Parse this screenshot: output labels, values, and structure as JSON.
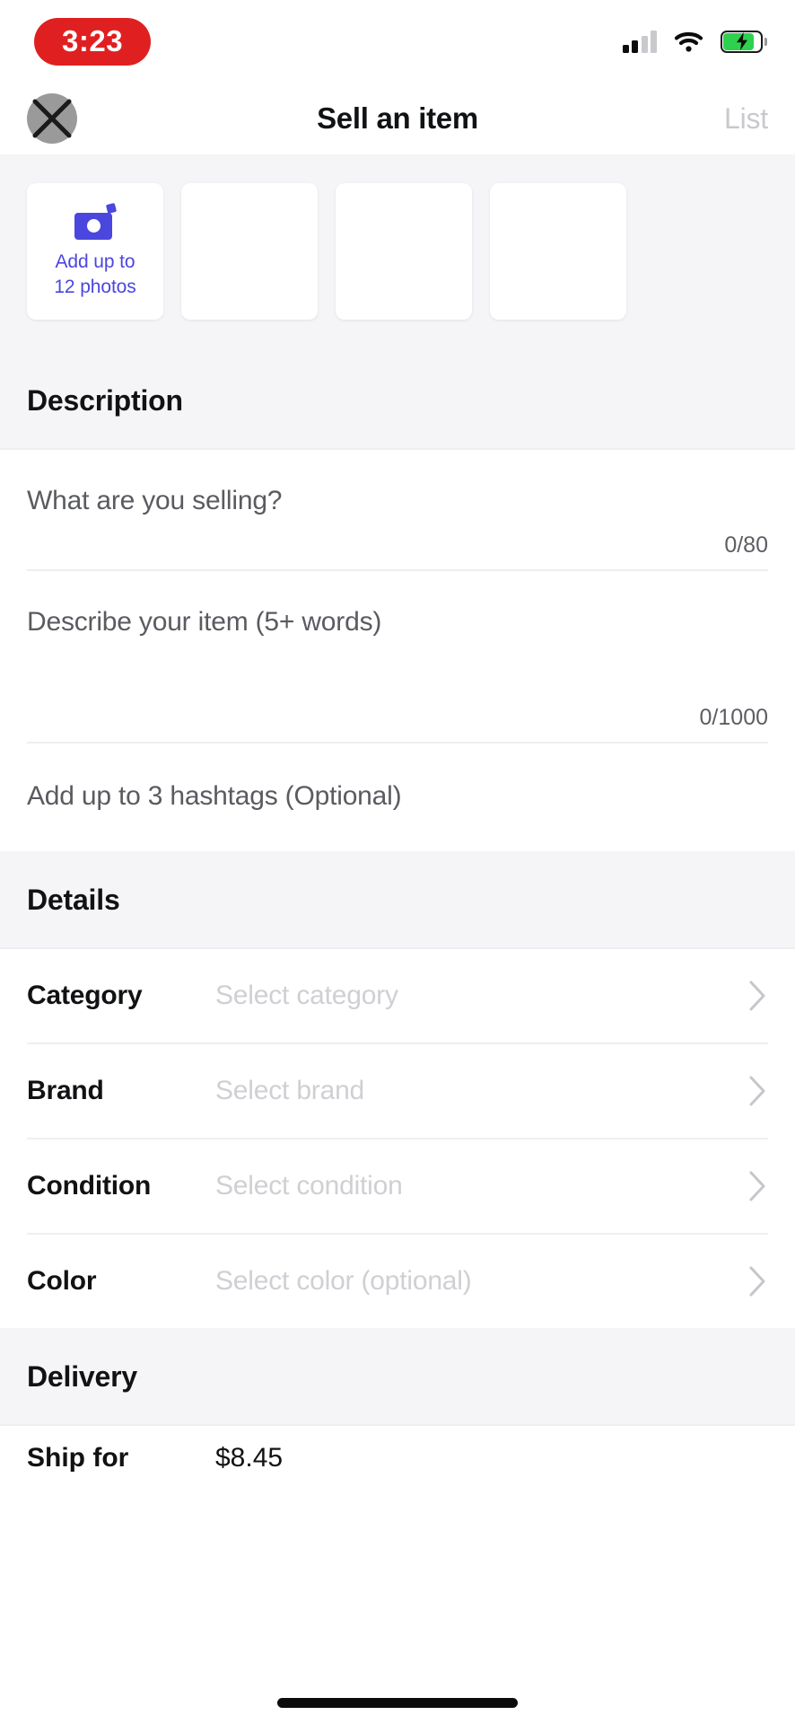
{
  "status_bar": {
    "time": "3:23",
    "time_pill_color": "#E02020",
    "signal_icon": "cellular-signal-icon",
    "wifi_icon": "wifi-icon",
    "battery_icon": "battery-charging-icon",
    "battery_fill_color": "#2ED14E"
  },
  "nav": {
    "close_icon": "close-icon",
    "title": "Sell an item",
    "action_label": "List"
  },
  "photos": {
    "add_label_line1": "Add up to",
    "add_label_line2": "12 photos",
    "camera_icon": "camera-icon",
    "accent_color": "#4B46DE",
    "empty_tiles": 3
  },
  "description_section": {
    "heading": "Description",
    "title_field": {
      "placeholder": "What are you selling?",
      "value": "",
      "counter": "0/80"
    },
    "desc_field": {
      "placeholder": "Describe your item (5+ words)",
      "value": "",
      "counter": "0/1000"
    },
    "hashtags_field": {
      "placeholder": "Add up to 3 hashtags (Optional)",
      "value": ""
    }
  },
  "details_section": {
    "heading": "Details",
    "rows": [
      {
        "label": "Category",
        "value": "Select category",
        "chevron": "chevron-right-icon"
      },
      {
        "label": "Brand",
        "value": "Select brand",
        "chevron": "chevron-right-icon"
      },
      {
        "label": "Condition",
        "value": "Select condition",
        "chevron": "chevron-right-icon"
      },
      {
        "label": "Color",
        "value": "Select color (optional)",
        "chevron": "chevron-right-icon"
      }
    ]
  },
  "delivery_section": {
    "heading": "Delivery",
    "peek_row": {
      "label": "Ship for",
      "value": "$8.45"
    }
  }
}
